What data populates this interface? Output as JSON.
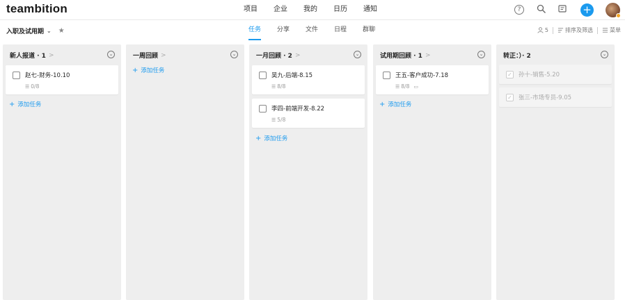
{
  "app": {
    "logo": "teambition"
  },
  "nav": [
    "项目",
    "企业",
    "我的",
    "日历",
    "通知"
  ],
  "icons": {
    "help": "?",
    "search": "⚲",
    "notes": "▭",
    "plus": "+"
  },
  "project": {
    "name": "入职及试用期",
    "chevron": "⌄",
    "star": "★"
  },
  "tabs": [
    {
      "label": "任务",
      "active": true
    },
    {
      "label": "分享",
      "active": false
    },
    {
      "label": "文件",
      "active": false
    },
    {
      "label": "日程",
      "active": false
    },
    {
      "label": "群聊",
      "active": false
    }
  ],
  "toolbar": {
    "members_count": "5",
    "sort_filter": "排序及筛选",
    "menu": "菜单"
  },
  "add_task_label": "添加任务",
  "columns": [
    {
      "title": "新人报道 · 1",
      "cards": [
        {
          "title": "赵七-财务-10.10",
          "subtasks": "0/8",
          "done": false,
          "comment": false
        }
      ]
    },
    {
      "title": "一周回顾",
      "cards": []
    },
    {
      "title": "一月回顾 · 2",
      "cards": [
        {
          "title": "吴九-后端-8.15",
          "subtasks": "8/8",
          "done": false,
          "comment": false
        },
        {
          "title": "李四-前端开发-8.22",
          "subtasks": "5/8",
          "done": false,
          "comment": false
        }
      ]
    },
    {
      "title": "试用期回顾 · 1",
      "cards": [
        {
          "title": "王五-客户成功-7.18",
          "subtasks": "8/8",
          "done": false,
          "comment": true
        }
      ]
    },
    {
      "title": "转正：）· 2",
      "cards": [
        {
          "title": "孙十-销售-5.20",
          "done": true
        },
        {
          "title": "张三-市场专员-9.05",
          "done": true
        }
      ]
    }
  ],
  "colors": {
    "accent": "#1b9aee",
    "column_bg": "#eeeeee"
  }
}
